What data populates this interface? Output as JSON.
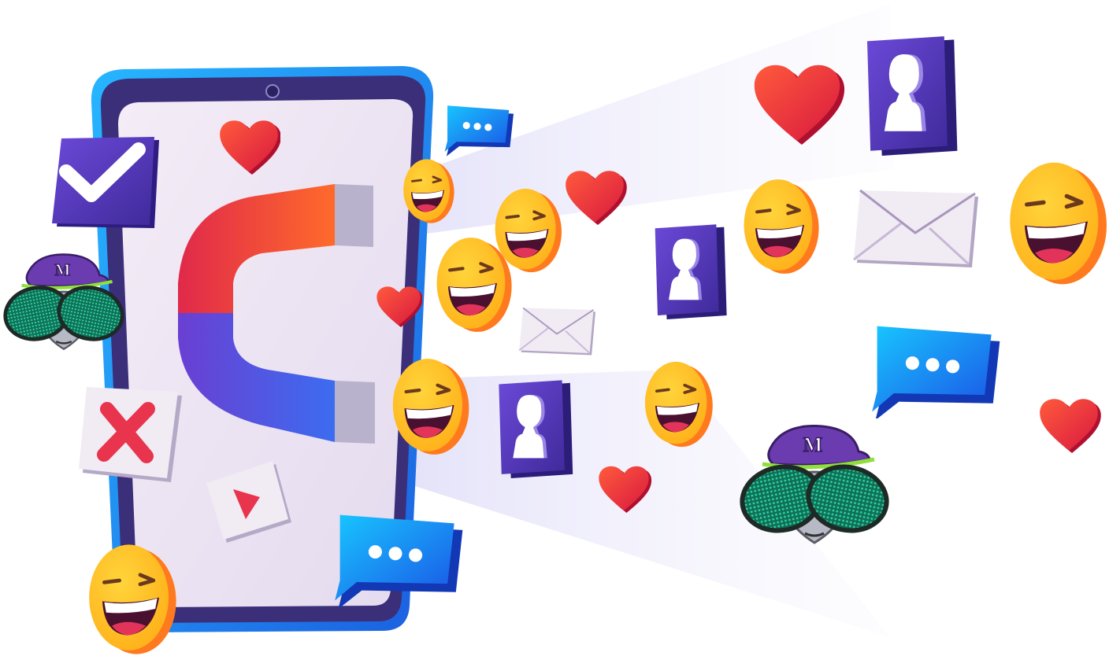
{
  "illustration": {
    "hat_letter": "M",
    "colors": {
      "phone_frame": "#1f8ff0",
      "phone_bezel": "#3b2f7a",
      "screen": "#efe6f3",
      "magnet_red": "#e8344d",
      "magnet_blue": "#4a5de8",
      "magnet_tip": "#b5aec9",
      "emoji_yellow": "#ffc21c",
      "emoji_rim": "#ff8a1f",
      "heart_red": "#e8344d",
      "chat_blue": "#1a73f0",
      "profile_purple": "#5b3bb5",
      "envelope": "#e9e2ee",
      "beam": "#c9c6ef",
      "mask_green": "#1d8a6b"
    },
    "icons": [
      "smartphone-icon",
      "magnet-icon",
      "checkmark-icon",
      "close-x-icon",
      "play-icon",
      "heart-icon",
      "smiley-face-icon",
      "chat-bubble-icon",
      "profile-card-icon",
      "envelope-icon",
      "mascot-icon"
    ]
  }
}
